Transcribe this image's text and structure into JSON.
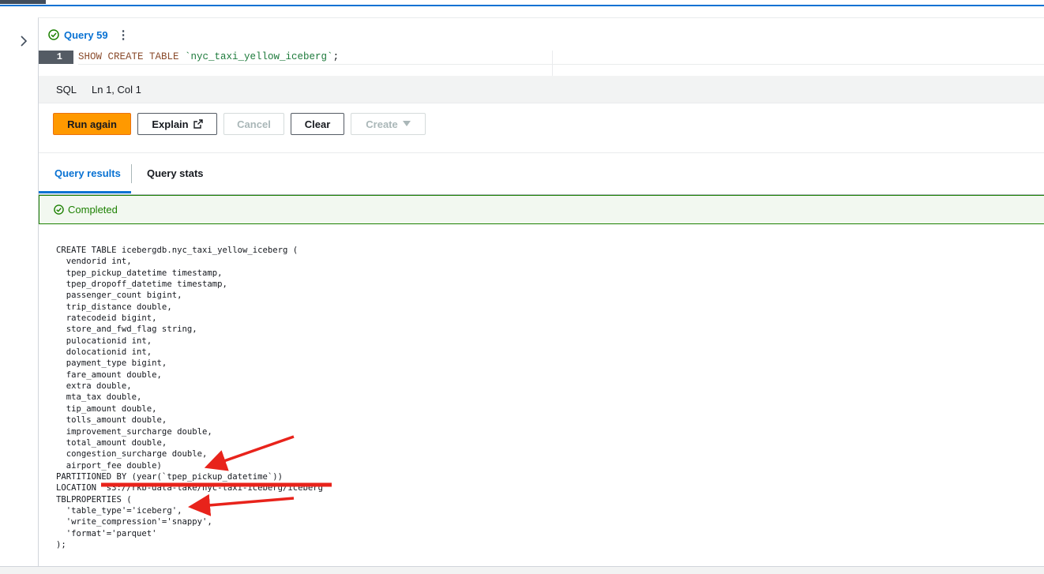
{
  "query_tab": {
    "label": "Query 59",
    "menu_icon": "more-vertical-icon",
    "status_icon": "check-circle-icon"
  },
  "editor": {
    "line_number": "1",
    "tokens": {
      "kw": "SHOW CREATE TABLE ",
      "str": "`nyc_taxi_yellow_iceberg`",
      "end": ";"
    }
  },
  "status_bar": {
    "language": "SQL",
    "position": "Ln 1, Col 1"
  },
  "buttons": {
    "run_again": "Run again",
    "explain": "Explain",
    "cancel": "Cancel",
    "clear": "Clear",
    "create": "Create"
  },
  "result_tabs": {
    "query_results": "Query results",
    "query_stats": "Query stats"
  },
  "status": {
    "text": "Completed",
    "color": "#1d8102"
  },
  "results_lines": [
    "CREATE TABLE icebergdb.nyc_taxi_yellow_iceberg (",
    "  vendorid int,",
    "  tpep_pickup_datetime timestamp,",
    "  tpep_dropoff_datetime timestamp,",
    "  passenger_count bigint,",
    "  trip_distance double,",
    "  ratecodeid bigint,",
    "  store_and_fwd_flag string,",
    "  pulocationid int,",
    "  dolocationid int,",
    "  payment_type bigint,",
    "  fare_amount double,",
    "  extra double,",
    "  mta_tax double,",
    "  tip_amount double,",
    "  tolls_amount double,",
    "  improvement_surcharge double,",
    "  total_amount double,",
    "  congestion_surcharge double,",
    "  airport_fee double)",
    "PARTITIONED BY (year(`tpep_pickup_datetime`))",
    "LOCATION 's3://rkb-data-lake/nyc-taxi-iceberg/iceberg",
    "TBLPROPERTIES (",
    "  'table_type'='iceberg',",
    "  'write_compression'='snappy',",
    "  'format'='parquet'",
    ");"
  ],
  "colors": {
    "accent": "#0972d3",
    "primary_button": "#ff9900",
    "annotation": "#e8231b"
  }
}
